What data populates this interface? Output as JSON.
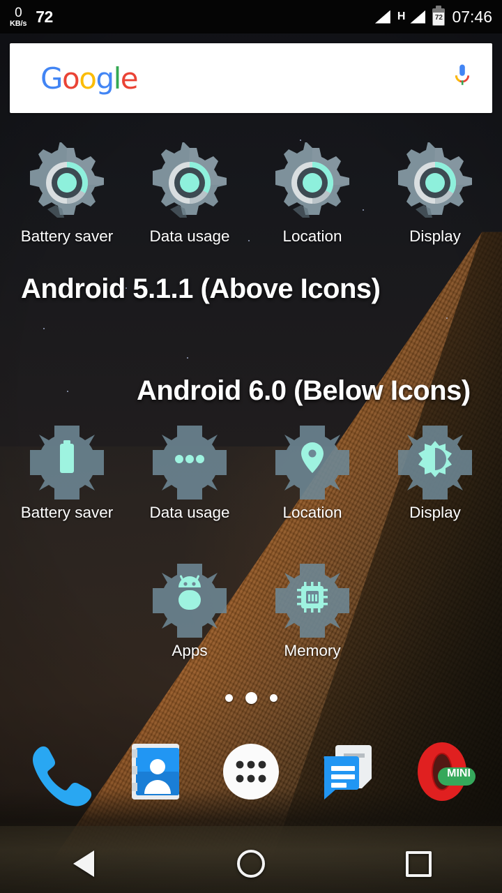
{
  "status_bar": {
    "net_speed_value": "0",
    "net_speed_unit": "KB/s",
    "notification_count": "72",
    "network_type": "H",
    "battery_percent": "72",
    "clock": "07:46",
    "signal_icon_1": "signal-bars-icon",
    "signal_icon_2": "signal-bars-icon",
    "battery_icon": "battery-icon"
  },
  "search": {
    "logo_letters": [
      {
        "char": "G",
        "color": "#4285F4"
      },
      {
        "char": "o",
        "color": "#EA4335"
      },
      {
        "char": "o",
        "color": "#FBBC05"
      },
      {
        "char": "g",
        "color": "#4285F4"
      },
      {
        "char": "l",
        "color": "#34A853"
      },
      {
        "char": "e",
        "color": "#EA4335"
      }
    ],
    "mic_icon": "microphone-icon"
  },
  "headings": {
    "above": "Android 5.1.1 (Above Icons)",
    "below": "Android 6.0 (Below Icons)"
  },
  "row_lollipop": [
    {
      "label": "Battery saver",
      "icon": "settings-gear-icon"
    },
    {
      "label": "Data usage",
      "icon": "settings-gear-icon"
    },
    {
      "label": "Location",
      "icon": "settings-gear-icon"
    },
    {
      "label": "Display",
      "icon": "settings-gear-icon"
    }
  ],
  "row_marshmallow_1": [
    {
      "label": "Battery saver",
      "icon": "battery-glyph-icon"
    },
    {
      "label": "Data usage",
      "icon": "three-dots-glyph-icon"
    },
    {
      "label": "Location",
      "icon": "map-pin-glyph-icon"
    },
    {
      "label": "Display",
      "icon": "brightness-glyph-icon"
    }
  ],
  "row_marshmallow_2": [
    {
      "label": "Apps",
      "icon": "android-robot-glyph-icon"
    },
    {
      "label": "Memory",
      "icon": "memory-chip-glyph-icon"
    }
  ],
  "page_indicator": {
    "count": 3,
    "active_index": 1
  },
  "dock": [
    {
      "name": "phone-app-icon",
      "label": "Phone"
    },
    {
      "name": "contacts-app-icon",
      "label": "Contacts"
    },
    {
      "name": "app-drawer-icon",
      "label": "Apps"
    },
    {
      "name": "messages-app-icon",
      "label": "Messages"
    },
    {
      "name": "opera-mini-app-icon",
      "label": "Opera Mini",
      "badge": "MINI"
    }
  ],
  "navigation": {
    "back": "back-button",
    "home": "home-button",
    "recents": "recents-button"
  },
  "colors": {
    "gear_m_body": "#6d8795",
    "gear_glyph": "#9ef3e0",
    "gear_l_body": "#7e919b",
    "accent_teal": "#8ef0dc",
    "phone_blue": "#2196F3",
    "opera_red": "#E02020",
    "opera_green": "#35A85B"
  }
}
